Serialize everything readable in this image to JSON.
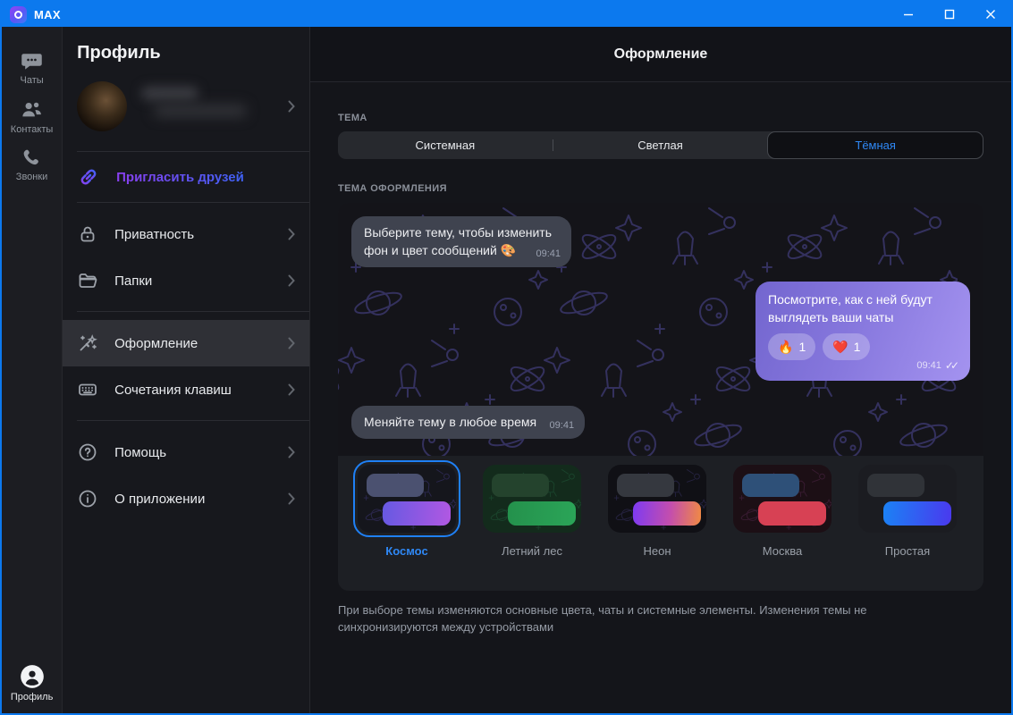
{
  "window": {
    "app_name": "MAX",
    "controls": {
      "minimize": "minimize",
      "maximize": "maximize",
      "close": "close"
    }
  },
  "colors": {
    "titlebar": "#0c79ee",
    "accent_blue": "#2f88f5",
    "outgoing_bubble_gradient": [
      "#7366cf",
      "#a493f0"
    ],
    "incoming_bubble": "#3f434f",
    "selected_ring": "#1f80f5"
  },
  "rail": {
    "items": [
      {
        "id": "chats",
        "label": "Чаты"
      },
      {
        "id": "contacts",
        "label": "Контакты"
      },
      {
        "id": "calls",
        "label": "Звонки"
      }
    ],
    "profile": {
      "label": "Профиль"
    }
  },
  "profile_panel": {
    "title": "Профиль",
    "invite": {
      "label": "Пригласить друзей"
    },
    "items": [
      {
        "id": "privacy",
        "label": "Приватность"
      },
      {
        "id": "folders",
        "label": "Папки"
      },
      {
        "id": "appearance",
        "label": "Оформление",
        "selected": true
      },
      {
        "id": "shortcuts",
        "label": "Сочетания клавиш"
      },
      {
        "id": "help",
        "label": "Помощь"
      },
      {
        "id": "about",
        "label": "О приложении"
      }
    ]
  },
  "appearance": {
    "header": "Оформление",
    "theme": {
      "label": "ТЕМА",
      "options": [
        "Системная",
        "Светлая",
        "Тёмная"
      ],
      "selected": "Тёмная"
    },
    "chat_theme_label": "ТЕМА ОФОРМЛЕНИЯ",
    "preview": {
      "messages": [
        {
          "direction": "in",
          "text": "Выберите тему, чтобы изменить фон и цвет сообщений 🎨",
          "time": "09:41"
        },
        {
          "direction": "out",
          "text": "Посмотрите, как с ней будут выглядеть ваши чаты",
          "time": "09:41",
          "read_receipt": "✓✓",
          "reactions": [
            {
              "emoji": "🔥",
              "count": "1"
            },
            {
              "emoji": "❤️",
              "count": "1"
            }
          ]
        },
        {
          "direction": "in",
          "text": "Меняйте тему в любое время",
          "time": "09:41"
        }
      ]
    },
    "chat_themes": [
      {
        "name": "Космос",
        "selected": true
      },
      {
        "name": "Летний лес"
      },
      {
        "name": "Неон"
      },
      {
        "name": "Москва"
      },
      {
        "name": "Простая"
      }
    ],
    "footnote": "При выборе темы изменяются основные цвета, чаты и системные элементы. Изменения темы не синхронизируются между устройствами"
  }
}
